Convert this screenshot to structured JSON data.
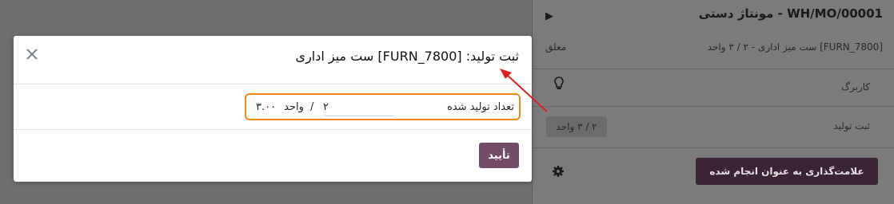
{
  "background_panel": {
    "title": "WH/MO/00001 - مونتاژ دستی",
    "product_line": "[FURN_7800] ست میز اداری - ۲ / ۳ واحد",
    "state": "معلق",
    "worksheet_label": "کاربرگ",
    "register_label": "ثبت تولید",
    "register_qty": "۲ / ۳ واحد",
    "mark_done_button": "علامت‌گذاری به عنوان انجام شده"
  },
  "modal": {
    "title": "ثبت تولید: [FURN_7800] ست میز اداری",
    "field_label": "تعداد تولید شده",
    "qty_done": "۲",
    "separator": "/",
    "qty_total": "۳.۰۰",
    "uom": "واحد",
    "confirm_button": "تأیید"
  },
  "colors": {
    "primary": "#714b67",
    "highlight_border": "#f0891a",
    "annotation_arrow": "#e02020"
  },
  "icons": {
    "close": "close-icon",
    "play": "play-icon",
    "bulb": "lightbulb-icon",
    "gear": "gear-icon"
  }
}
